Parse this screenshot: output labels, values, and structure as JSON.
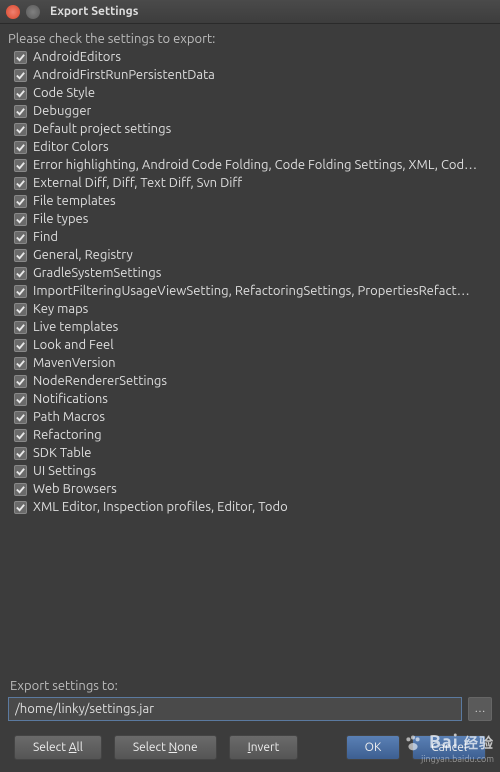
{
  "window": {
    "title": "Export Settings"
  },
  "prompt": "Please check the settings to export:",
  "items": [
    "AndroidEditors",
    "AndroidFirstRunPersistentData",
    "Code Style",
    "Debugger",
    "Default project settings",
    "Editor Colors",
    "Error highlighting, Android Code Folding, Code Folding Settings, XML, Cod…",
    "External Diff, Diff, Text Diff, Svn Diff",
    "File templates",
    "File types",
    "Find",
    "General, Registry",
    "GradleSystemSettings",
    "ImportFilteringUsageViewSetting, RefactoringSettings, PropertiesRefact…",
    "Key maps",
    "Live templates",
    "Look and Feel",
    "MavenVersion",
    "NodeRendererSettings",
    "Notifications",
    "Path Macros",
    "Refactoring",
    "SDK Table",
    "UI Settings",
    "Web Browsers",
    "XML Editor, Inspection profiles, Editor, Todo"
  ],
  "export_label": "Export settings to:",
  "export_path": "/home/linky/settings.jar",
  "browse": "…",
  "buttons": {
    "select_all_pre": "Select ",
    "select_all_u": "A",
    "select_all_post": "ll",
    "select_none_pre": "Select ",
    "select_none_u": "N",
    "select_none_post": "one",
    "invert_pre": "",
    "invert_u": "I",
    "invert_post": "nvert",
    "ok": "OK",
    "cancel": "Cancel"
  },
  "watermark": {
    "line1": "Bai",
    "line2": "经验",
    "line3": "jingyan.baidu.com"
  }
}
